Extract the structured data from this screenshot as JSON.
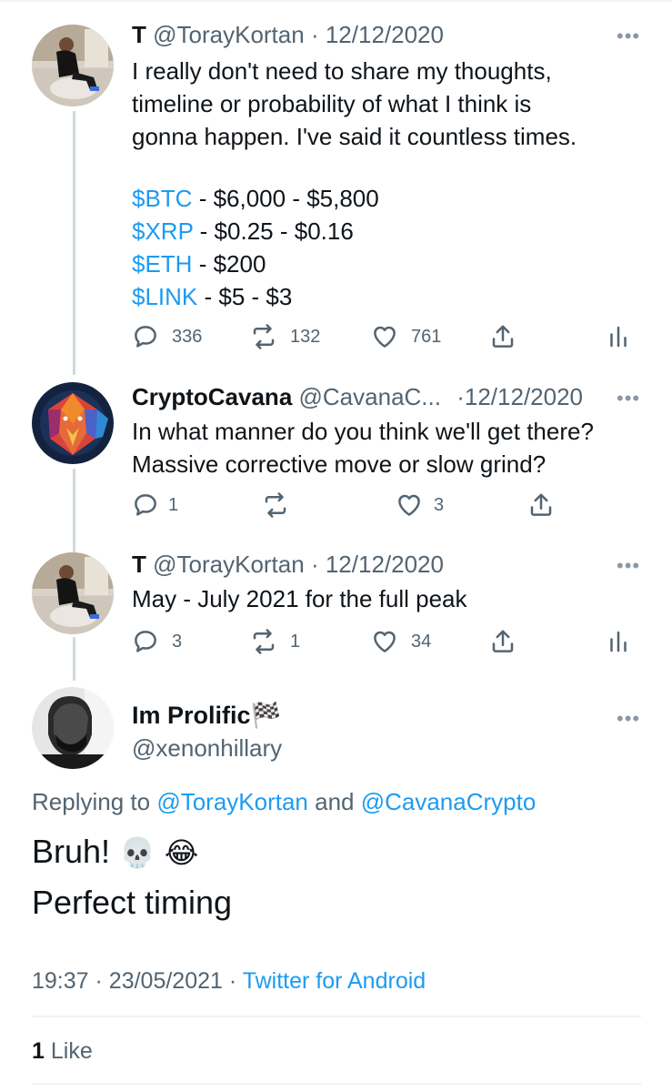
{
  "tweets": [
    {
      "name": "T",
      "handle": "@TorayKortan",
      "sep": "·",
      "date": "12/12/2020",
      "more": "•••",
      "lines": [
        "I really don't need to share my thoughts,",
        "timeline or probability of what I think is",
        "gonna happen. I've said it countless times."
      ],
      "predictions": [
        {
          "tag": "$BTC",
          "text": " - $6,000 - $5,800"
        },
        {
          "tag": "$XRP",
          "text": " - $0.25 - $0.16"
        },
        {
          "tag": "$ETH",
          "text": " - $200"
        },
        {
          "tag": "$LINK",
          "text": " - $5 - $3"
        }
      ],
      "replies": "336",
      "retweets": "132",
      "likes": "761"
    },
    {
      "name": "CryptoCavana",
      "handle": "@CavanaC...",
      "sep": "·",
      "date": "12/12/2020",
      "more": "•••",
      "lines": [
        "In what manner do you think we'll get there?",
        "Massive corrective move or slow grind?"
      ],
      "replies": "1",
      "retweets": "",
      "likes": "3"
    },
    {
      "name": "T",
      "handle": "@TorayKortan",
      "sep": "·",
      "date": "12/12/2020",
      "more": "•••",
      "lines": [
        "May - July 2021 for the full peak"
      ],
      "replies": "3",
      "retweets": "1",
      "likes": "34"
    }
  ],
  "main_tweet": {
    "name": "Im Prolific",
    "flag": "🏁",
    "handle": "@xenonhillary",
    "more": "•••",
    "replying_prefix": "Replying to ",
    "replying_user1": "@TorayKortan",
    "replying_and": " and ",
    "replying_user2": "@CavanaCrypto",
    "line1": "Bruh!",
    "emoji1": "💀",
    "emoji2": "😂",
    "line2": "Perfect timing",
    "time": "19:37",
    "sep": "·",
    "date": "23/05/2021",
    "client": "Twitter for Android",
    "like_count": "1",
    "like_label": "Like"
  },
  "icons": {
    "reply": "reply-icon",
    "retweet": "retweet-icon",
    "like": "heart-icon",
    "share": "share-icon",
    "analytics": "analytics-icon"
  },
  "colors": {
    "link": "#1d9bf0",
    "secondary_text": "#536471",
    "thread_line": "#cfd9de"
  }
}
